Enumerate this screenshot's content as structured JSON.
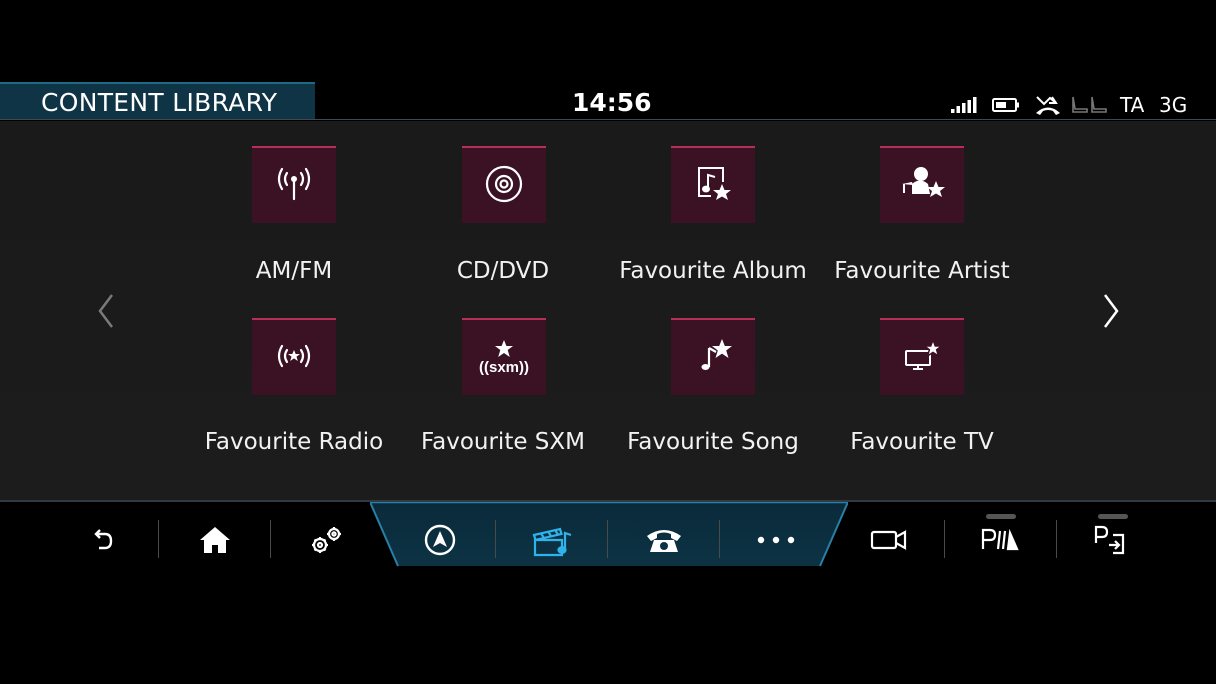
{
  "header": {
    "title": "CONTENT LIBRARY",
    "clock": "14:56",
    "status": {
      "signal_icon": "signal-bars-icon",
      "battery_icon": "battery-icon",
      "seat_icon": "seat-icon",
      "ta_label": "TA",
      "network_label": "3G"
    }
  },
  "library": {
    "items": [
      {
        "label": "AM/FM",
        "icon": "radio-antenna-icon"
      },
      {
        "label": "CD/DVD",
        "icon": "disc-icon"
      },
      {
        "label": "Favourite Album",
        "icon": "album-star-icon"
      },
      {
        "label": "Favourite Artist",
        "icon": "artist-star-icon"
      },
      {
        "label": "Favourite Radio",
        "icon": "radio-star-icon"
      },
      {
        "label": "Favourite SXM",
        "icon": "sxm-star-icon"
      },
      {
        "label": "Favourite Song",
        "icon": "note-star-icon"
      },
      {
        "label": "Favourite TV",
        "icon": "tv-star-icon"
      }
    ],
    "sxm_logo_text": "((sxm))"
  },
  "nav": {
    "items": [
      "back-icon",
      "home-icon",
      "settings-icon",
      "navigation-icon",
      "media-icon",
      "phone-icon",
      "more-icon",
      "camera-icon",
      "park-assist-icon",
      "park-exit-icon"
    ]
  },
  "colors": {
    "accent": "#1e8fc0",
    "tile": "#3a1224",
    "tile_edge": "#b52f57",
    "active_nav_icon": "#2fb3ea"
  }
}
